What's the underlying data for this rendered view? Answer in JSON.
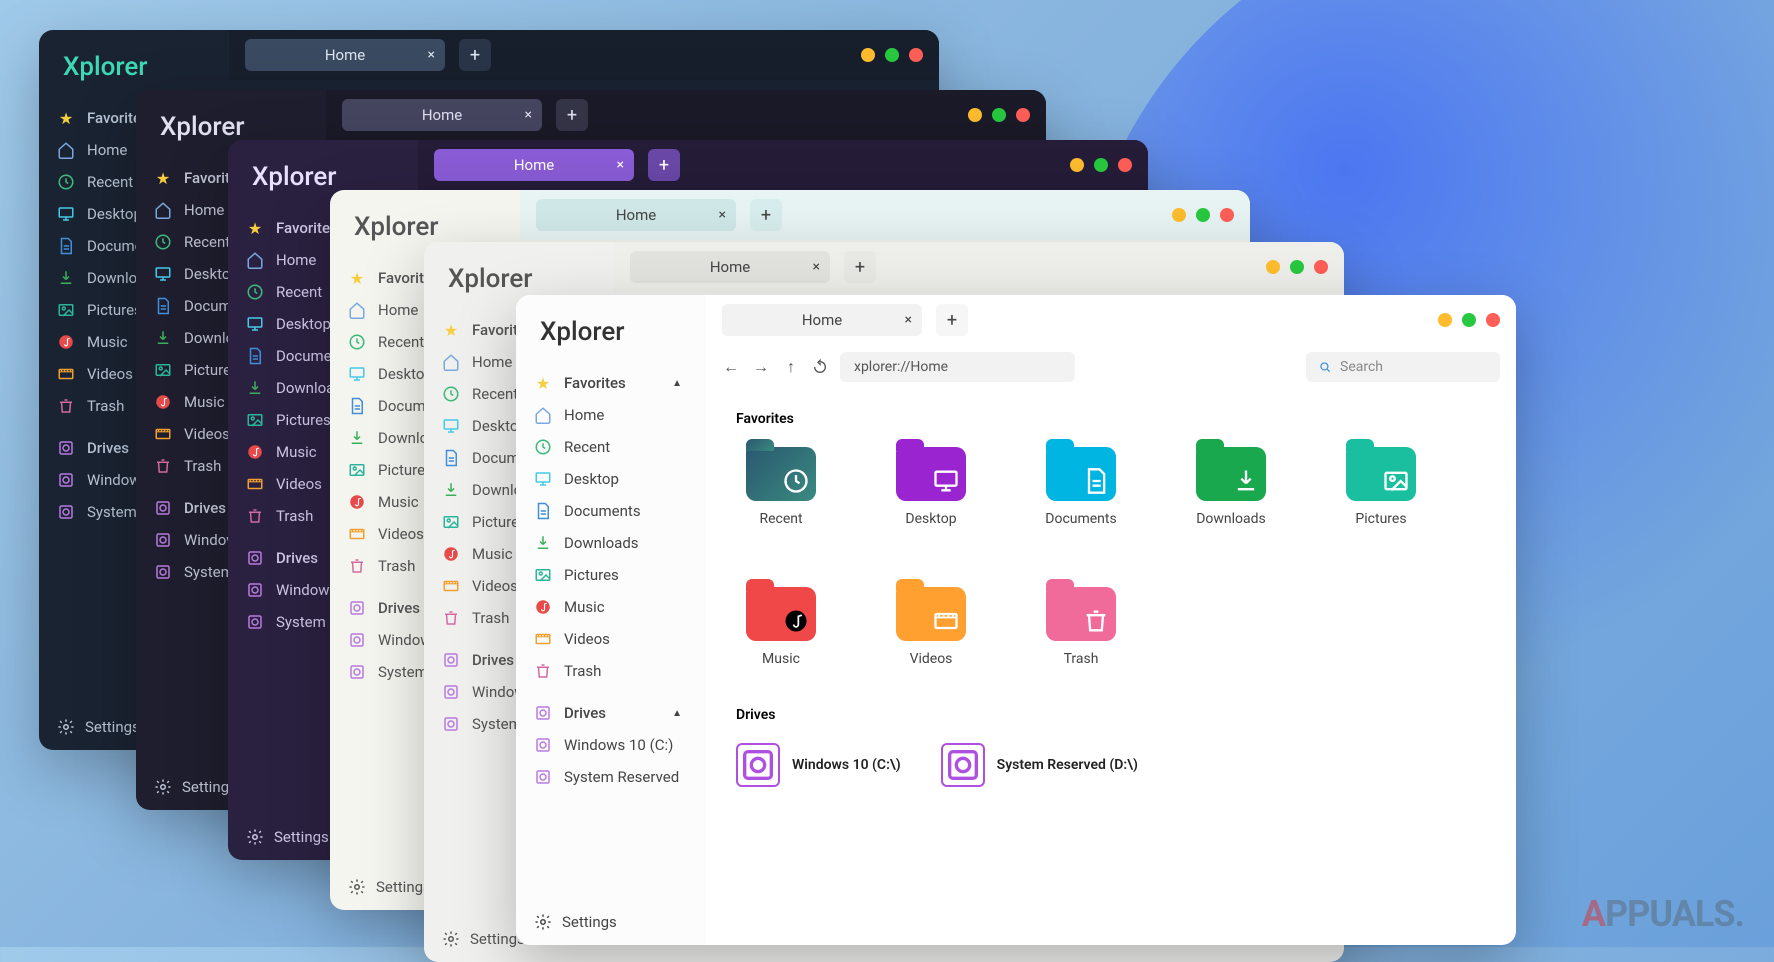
{
  "app_name": "Xplorer",
  "tab": {
    "label": "Home",
    "close": "×",
    "add": "+"
  },
  "nav": {
    "address": "xplorer://Home",
    "search_placeholder": "Search"
  },
  "sidebar": {
    "favorites_header": "Favorites",
    "items": [
      {
        "icon": "home",
        "label": "Home",
        "color": "#7aa7e0"
      },
      {
        "icon": "recent",
        "label": "Recent",
        "color": "#3fb97a"
      },
      {
        "icon": "desktop",
        "label": "Desktop",
        "color": "#45c9e8"
      },
      {
        "icon": "documents",
        "label": "Documents",
        "color": "#418ed9"
      },
      {
        "icon": "downloads",
        "label": "Downloads",
        "color": "#3bb05a"
      },
      {
        "icon": "pictures",
        "label": "Pictures",
        "color": "#2bb59a"
      },
      {
        "icon": "music",
        "label": "Music",
        "color": "#e84a4a"
      },
      {
        "icon": "videos",
        "label": "Videos",
        "color": "#f0a030"
      },
      {
        "icon": "trash",
        "label": "Trash",
        "color": "#d26aa0"
      }
    ],
    "drives_header": "Drives",
    "drives": [
      {
        "label": "Windows 10 (C:)"
      },
      {
        "label": "System Reserved"
      }
    ],
    "settings": "Settings"
  },
  "content": {
    "favorites_title": "Favorites",
    "favorites": [
      {
        "name": "Recent",
        "bg": "linear-gradient(135deg,#2a5870,#3a8a80)",
        "glyph": "recent"
      },
      {
        "name": "Desktop",
        "bg": "#9a24d0",
        "glyph": "desktop"
      },
      {
        "name": "Documents",
        "bg": "#00b5e2",
        "glyph": "documents"
      },
      {
        "name": "Downloads",
        "bg": "#1aa84e",
        "glyph": "downloads"
      },
      {
        "name": "Pictures",
        "bg": "#1abfa0",
        "glyph": "pictures"
      },
      {
        "name": "Music",
        "bg": "#f04848",
        "glyph": "music"
      },
      {
        "name": "Videos",
        "bg": "#ffa030",
        "glyph": "videos"
      },
      {
        "name": "Trash",
        "bg": "#f06a9a",
        "glyph": "trash"
      }
    ],
    "drives_title": "Drives",
    "drives": [
      {
        "label": "Windows 10 (C:\\)"
      },
      {
        "label": "System Reserved (D:\\)"
      }
    ]
  },
  "watermark": {
    "a": "A",
    "rest": "PPUALS"
  }
}
